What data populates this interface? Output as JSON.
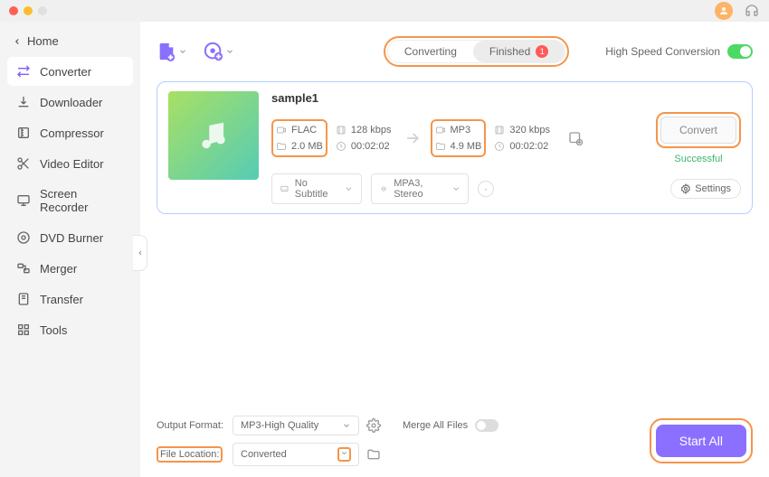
{
  "titlebar": {
    "avatar_initial": ""
  },
  "sidebar": {
    "home_label": "Home",
    "items": [
      {
        "label": "Converter",
        "icon": "converter"
      },
      {
        "label": "Downloader",
        "icon": "downloader"
      },
      {
        "label": "Compressor",
        "icon": "compressor"
      },
      {
        "label": "Video Editor",
        "icon": "video-editor"
      },
      {
        "label": "Screen Recorder",
        "icon": "screen-recorder"
      },
      {
        "label": "DVD Burner",
        "icon": "dvd-burner"
      },
      {
        "label": "Merger",
        "icon": "merger"
      },
      {
        "label": "Transfer",
        "icon": "transfer"
      },
      {
        "label": "Tools",
        "icon": "tools"
      }
    ]
  },
  "toolbar": {
    "tabs": {
      "converting_label": "Converting",
      "finished_label": "Finished",
      "finished_count": "1"
    },
    "high_speed_label": "High Speed Conversion"
  },
  "file": {
    "title": "sample1",
    "source": {
      "format": "FLAC",
      "bitrate": "128 kbps",
      "size": "2.0 MB",
      "duration": "00:02:02"
    },
    "target": {
      "format": "MP3",
      "bitrate": "320 kbps",
      "size": "4.9 MB",
      "duration": "00:02:02"
    },
    "convert_label": "Convert",
    "status": "Successful",
    "subtitle_label": "No Subtitle",
    "audio_label": "MPA3, Stereo",
    "settings_label": "Settings"
  },
  "bottom": {
    "output_format_label": "Output Format:",
    "output_format_value": "MP3-High Quality",
    "file_location_label": "File Location:",
    "file_location_value": "Converted",
    "merge_label": "Merge All Files",
    "start_label": "Start All"
  }
}
